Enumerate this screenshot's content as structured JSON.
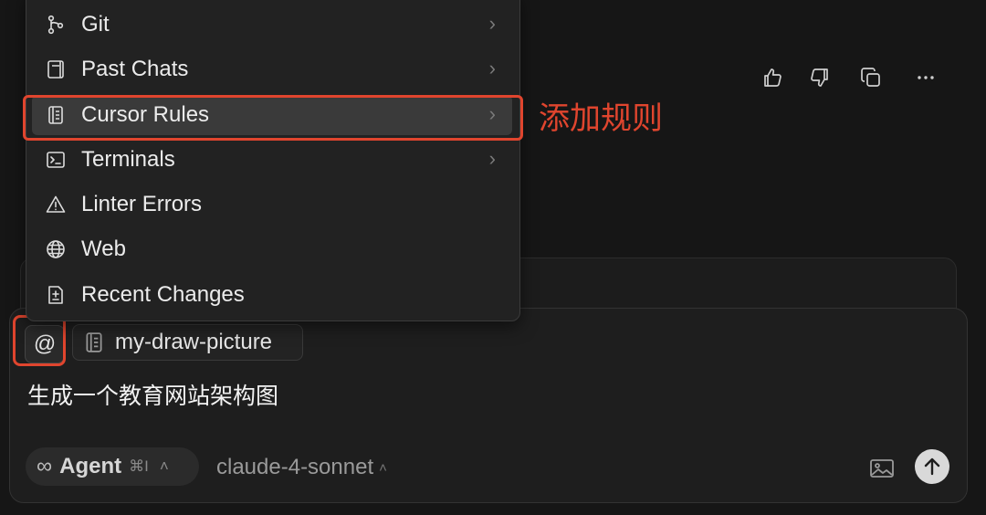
{
  "menu": {
    "items": [
      {
        "label": "Git",
        "icon": "git-branch-icon",
        "has_submenu": true
      },
      {
        "label": "Past Chats",
        "icon": "past-chats-icon",
        "has_submenu": true
      },
      {
        "label": "Cursor Rules",
        "icon": "rules-icon",
        "has_submenu": true,
        "active": true
      },
      {
        "label": "Terminals",
        "icon": "terminal-icon",
        "has_submenu": true
      },
      {
        "label": "Linter Errors",
        "icon": "warning-icon",
        "has_submenu": false
      },
      {
        "label": "Web",
        "icon": "globe-icon",
        "has_submenu": false
      },
      {
        "label": "Recent Changes",
        "icon": "recent-changes-icon",
        "has_submenu": false
      }
    ],
    "submenu_arrow": "›"
  },
  "annotation": {
    "text": "添加规则",
    "color": "#e0452e"
  },
  "input": {
    "mention_symbol": "@",
    "context_chip": "my-draw-picture",
    "prompt_text": "生成一个教育网站架构图"
  },
  "footer": {
    "mode_icon": "∞",
    "mode_label": "Agent",
    "mode_shortcut": "⌘I",
    "mode_chevron": "˄",
    "model_name": "claude-4-sonnet",
    "model_chevron": "˄"
  },
  "colors": {
    "background": "#161616",
    "accent_red": "#e0452e",
    "send_button": "#d9d9d9"
  }
}
